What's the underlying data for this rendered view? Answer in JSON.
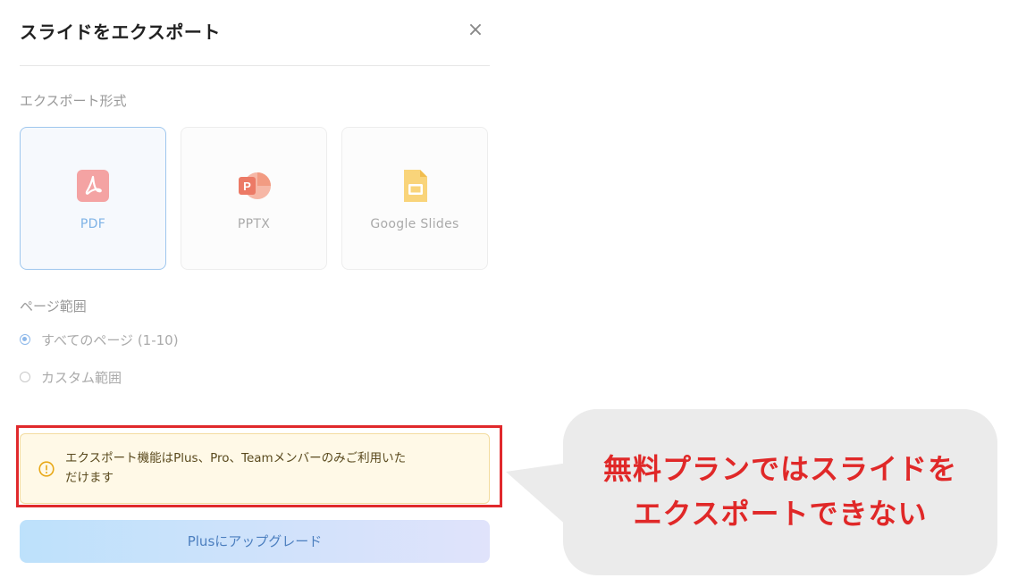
{
  "dialog": {
    "title": "スライドをエクスポート",
    "close_label": "×"
  },
  "export_format": {
    "section_label": "エクスポート形式",
    "options": [
      {
        "label": "PDF",
        "icon": "pdf-icon",
        "selected": true,
        "color": "#f4a3a3"
      },
      {
        "label": "PPTX",
        "icon": "powerpoint-icon",
        "selected": false,
        "color": "#f08a78"
      },
      {
        "label": "Google Slides",
        "icon": "google-slides-icon",
        "selected": false,
        "color": "#f9d47a"
      }
    ]
  },
  "page_range": {
    "section_label": "ページ範囲",
    "options": [
      {
        "label": "すべてのページ (1-10)",
        "checked": true
      },
      {
        "label": "カスタム範囲",
        "checked": false
      }
    ]
  },
  "notice": {
    "text_line1": "エクスポート機能はPlus、Pro、Teamメンバーのみご利用いた",
    "text_line2": "だけます",
    "icon": "warning-circle-icon"
  },
  "upgrade_button": {
    "label": "Plusにアップグレード"
  },
  "callout": {
    "line1": "無料プランではスライドを",
    "line2": "エクスポートできない",
    "text_color": "#e02828",
    "bubble_color": "#ebebeb"
  },
  "colors": {
    "highlight_border": "#e0292c",
    "selected_border": "#9fc7ee"
  }
}
